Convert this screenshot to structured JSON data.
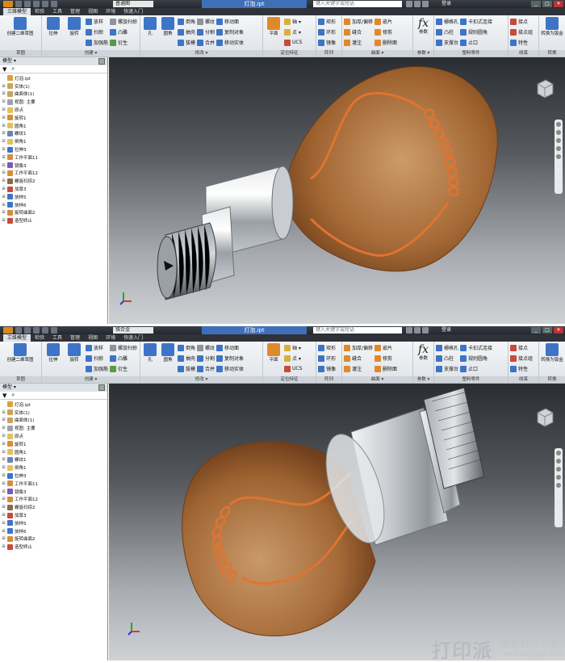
{
  "app": {
    "document_title": "灯泡.ipt",
    "search_placeholder": "键入关键字或短语",
    "login_label": "登录",
    "material": "铬合金",
    "material_b_top": "普通图",
    "window_buttons": [
      "_",
      "□",
      "✕"
    ]
  },
  "tabs": [
    "三维模型",
    "检验",
    "工具",
    "管理",
    "视图",
    "环境",
    "快速入门"
  ],
  "ribbon": {
    "sketch": {
      "create_2d_sketch": "创建二维草图",
      "footer": "草图"
    },
    "create": {
      "extrude": "拉伸",
      "revolve": "旋转",
      "loft": "放样",
      "sweep": "扫掠",
      "emboss_like": "加强筋",
      "coil": "螺旋扫掠",
      "emboss": "凸雕",
      "derive": "衍生",
      "footer": "创建 ▾"
    },
    "modify": {
      "hole": "孔",
      "fillet": "圆角",
      "chamfer": "倒角",
      "shell": "抽壳",
      "draft": "拔模",
      "thread": "螺纹",
      "split": "分割",
      "combine": "合并",
      "move_face": "移动面",
      "copy_object": "复制对象",
      "move_bodies": "移动实体",
      "footer": "修改 ▾"
    },
    "work_features": {
      "plane": "平面",
      "axis": "轴 ▾",
      "point": "点 ▾",
      "ucs": "UCS",
      "footer": "定位特征"
    },
    "pattern": {
      "rectangular": "矩形",
      "circular": "环形",
      "mirror": "镜像",
      "footer": "阵列"
    },
    "surface": {
      "thicken": "加厚/偏移",
      "stitch": "缝合",
      "patch": "灌注",
      "sculpt": "嵌片",
      "trim": "修剪",
      "delete_face": "删除面",
      "footer": "曲面 ▾"
    },
    "parameters": {
      "fx": "fx",
      "label": "参数",
      "footer": "参数 ▾"
    },
    "plastic": {
      "grill": "栅格孔",
      "boss": "凸柱",
      "rest": "支撑台",
      "snap_fit": "卡扣式连接",
      "rule_fillet": "规则圆角",
      "lip": "止口",
      "footer": "塑料零件"
    },
    "harness": {
      "contact": "接点",
      "contact_set": "接点组",
      "props": "特性",
      "footer": "线束"
    },
    "convert": {
      "sheetmetal": "转换为钣金",
      "footer": "转换"
    }
  },
  "browser": {
    "title": "模型 ▾",
    "close": "?",
    "items": [
      {
        "label": "灯泡.ipt",
        "root": true,
        "color": "#d7a23b"
      },
      {
        "label": "实体(1)",
        "color": "#c9a55a"
      },
      {
        "label": "曲面体(1)",
        "color": "#c9a55a"
      },
      {
        "label": "视图: 主要",
        "color": "#9aa3ad"
      },
      {
        "label": "原点",
        "color": "#e2c15a"
      },
      {
        "label": "旋转1",
        "color": "#d68d3a"
      },
      {
        "label": "圆角1",
        "color": "#e2c15a"
      },
      {
        "label": "螺纹1",
        "color": "#6a84b8"
      },
      {
        "label": "倒角1",
        "color": "#e2c15a"
      },
      {
        "label": "拉伸3",
        "color": "#3d74c6"
      },
      {
        "label": "工作平面11",
        "color": "#d68d3a"
      },
      {
        "label": "镜像3",
        "color": "#7a5ab8"
      },
      {
        "label": "工作平面12",
        "color": "#d68d3a"
      },
      {
        "label": "螺旋扫掠2",
        "color": "#8a6a4a"
      },
      {
        "label": "加厚3",
        "color": "#c84a3a"
      },
      {
        "label": "放样5",
        "color": "#3d74c6"
      },
      {
        "label": "放样6",
        "color": "#3d74c6"
      },
      {
        "label": "旋转曲面2",
        "color": "#d68d3a"
      },
      {
        "label": "造型终止",
        "color": "#c84a3a"
      }
    ]
  },
  "watermark": {
    "logo": "打印派",
    "line1": "模型 打印 分享",
    "line2": "www.dayinpai.com"
  },
  "colors": {
    "glass": "#b9733a",
    "filament": "#e07430",
    "metal": "#d2d6da",
    "accent": "#3f6fb8"
  }
}
